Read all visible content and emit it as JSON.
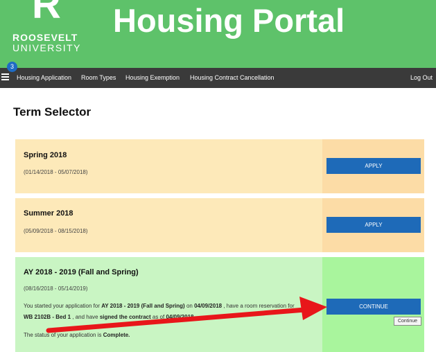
{
  "branding": {
    "logo_letter": "R",
    "logo_line1": "ROOSEVELT",
    "logo_line2": "UNIVERSITY",
    "site_title": "Housing Portal"
  },
  "nav": {
    "badge_count": "3",
    "items": [
      {
        "label": "Housing Application"
      },
      {
        "label": "Room Types"
      },
      {
        "label": "Housing Exemption"
      },
      {
        "label": "Housing Contract Cancellation"
      }
    ],
    "logout": "Log Out"
  },
  "page_title": "Term Selector",
  "terms": [
    {
      "name": "Spring 2018",
      "dates": "(01/14/2018 - 05/07/2018)",
      "button": "APPLY"
    },
    {
      "name": "Summer 2018",
      "dates": "(05/09/2018 - 08/15/2018)",
      "button": "APPLY"
    },
    {
      "name": "AY 2018 - 2019 (Fall and Spring)",
      "dates": "(08/16/2018 - 05/14/2019)",
      "button": "CONTINUE",
      "message": {
        "p1": "You started your application for ",
        "term": "AY 2018 - 2019 (Fall and Spring)",
        "p2": " on ",
        "start_date": "04/09/2018",
        "p3": " , have a room reservation for",
        "room": "WB 2102B - Bed 1",
        "p4": " , and have ",
        "contract": "signed the contract",
        "p5": " as of ",
        "contract_date": "04/09/2018",
        "status_prefix": "The status of your application is ",
        "status": "Complete."
      }
    }
  ],
  "tooltip": "Continue",
  "colors": {
    "header_green": "#5ec26a",
    "nav_dark": "#3a3a3a",
    "button_blue": "#1e6ab8",
    "pending_card": "#fde9b9",
    "active_card": "#c9f5c3",
    "annotation_arrow": "#e8161a"
  }
}
